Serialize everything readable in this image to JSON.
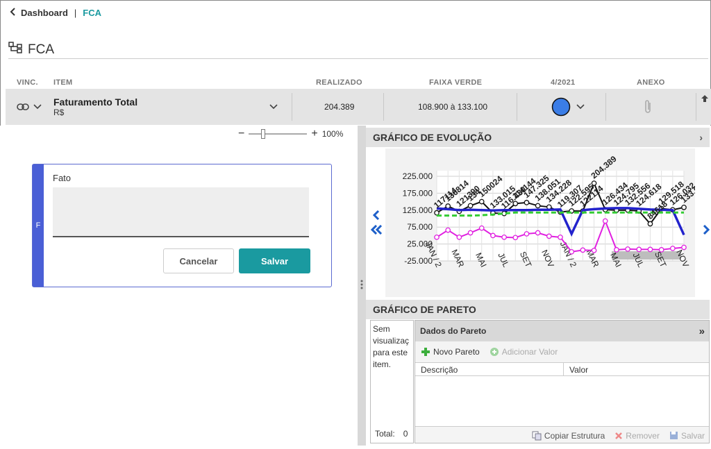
{
  "breadcrumb": {
    "back": "Dashboard",
    "separator": "|",
    "current": "FCA"
  },
  "page": {
    "title": "FCA"
  },
  "columns": {
    "vinc": "VINC.",
    "item": "ITEM",
    "realizado": "REALIZADO",
    "faixa": "FAIXA VERDE",
    "period": "4/2021",
    "anexo": "ANEXO"
  },
  "row": {
    "item_name": "Faturamento Total",
    "unit": "R$",
    "realizado": "204.389",
    "faixa": "108.900 à 133.100",
    "status_color": "#3b7de6"
  },
  "zoom": {
    "minus": "−",
    "plus": "+",
    "level": "100%",
    "value": 0.22
  },
  "card": {
    "flag": "F",
    "label": "Fato",
    "text": "",
    "cancel": "Cancelar",
    "save": "Salvar"
  },
  "evolution": {
    "title": "GRÁFICO DE EVOLUÇÃO"
  },
  "pareto": {
    "title": "GRÁFICO DE PARETO",
    "empty": [
      "Sem",
      "visualizaç",
      "para este",
      "item."
    ],
    "total_label": "Total:",
    "total_value": "0",
    "panel_title": "Dados do Pareto",
    "new": "Novo Pareto",
    "add": "Adicionar Valor",
    "col_desc": "Descrição",
    "col_val": "Valor",
    "copy": "Copiar Estrutura",
    "remove": "Remover",
    "save": "Salvar"
  },
  "chart_data": {
    "type": "line",
    "ylim": [
      -25000,
      225000
    ],
    "yticks": [
      "225.000",
      "175.000",
      "125.000",
      "75.000",
      "25.000",
      "-25.000"
    ],
    "xticks": [
      "JAN / 2",
      "MAR",
      "MAI",
      "JUL",
      "SET",
      "NOV",
      "JAN / 2",
      "MAR",
      "MAI",
      "JUL",
      "SET",
      "NOV"
    ],
    "series": [
      {
        "color": "#111111",
        "values": [
          117114,
          136814,
          121390,
          138000,
          150024,
          116430,
          115000,
          144354,
          147325,
          138051,
          134228,
          119307,
          122595,
          122114,
          204389,
          126434,
          124795,
          125000,
          122556,
          84618,
          129518,
          126032,
          133092
        ]
      },
      {
        "color": "#2222cc",
        "values": [
          130000,
          128000,
          125000,
          126000,
          125000,
          124000,
          125000,
          125000,
          125000,
          126000,
          126000,
          127000,
          55000,
          125000,
          128000,
          130000,
          131000,
          131000,
          129000,
          127000,
          126000,
          125000,
          52000
        ]
      },
      {
        "color": "#e020e0",
        "values": [
          45000,
          66000,
          45000,
          58000,
          72000,
          50000,
          45000,
          44000,
          55000,
          58000,
          48000,
          45000,
          2000,
          7000,
          6000,
          93000,
          8000,
          10000,
          9000,
          9000,
          8000,
          12000,
          15000
        ]
      },
      {
        "color": "#33cc33",
        "values": [
          108900,
          108900,
          108900,
          108900,
          110000,
          112000,
          115000,
          118000,
          118000,
          118000,
          118000,
          118000,
          118000,
          118000,
          118000,
          118000,
          118000,
          118000,
          118000,
          118000,
          118000,
          118000,
          118000
        ]
      }
    ],
    "data_labels": [
      "117114",
      "136814",
      "121390",
      "134",
      "150024",
      "133.015",
      "116.430",
      "114144",
      "147.325",
      "138.051",
      "134.228",
      "119.307",
      "122.595",
      "122114",
      "204.389",
      "126.434",
      "124.795",
      "132.556",
      "124.618",
      "84618",
      "129.518",
      "126.032",
      "133.092"
    ]
  }
}
